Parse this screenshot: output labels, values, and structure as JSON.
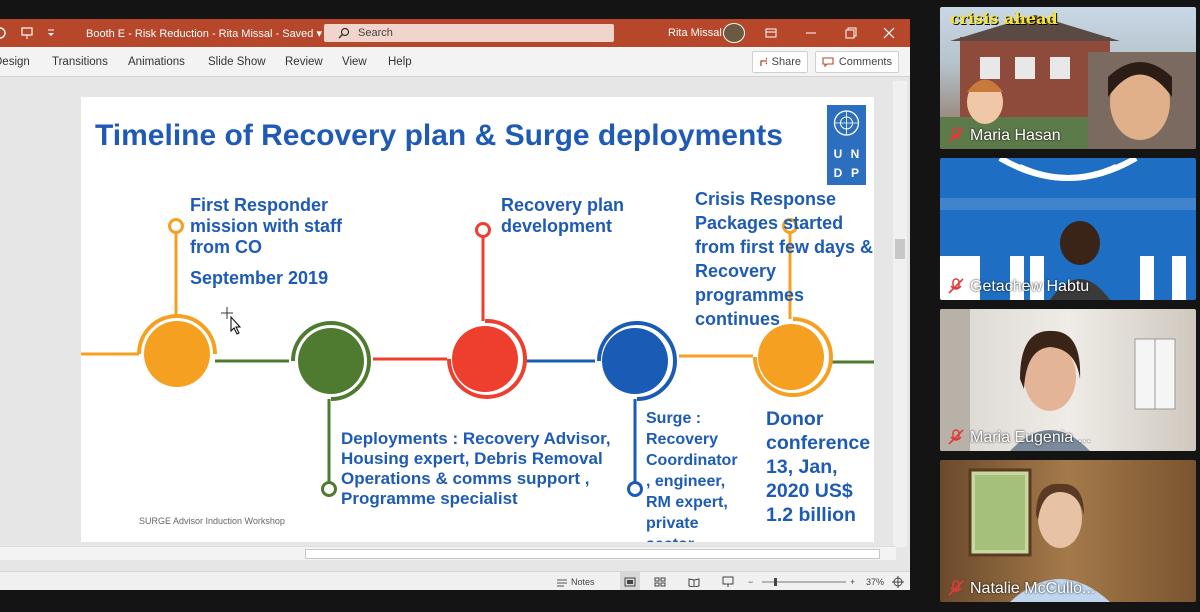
{
  "ppt": {
    "doc_title": "Booth E - Risk Reduction - Rita Missal  -  Saved  ▾",
    "search_placeholder": "Search",
    "user_name": "Rita Missal",
    "tabs": [
      "Design",
      "Transitions",
      "Animations",
      "Slide Show",
      "Review",
      "View",
      "Help"
    ],
    "share_label": "Share",
    "comments_label": "Comments",
    "notes_label": "Notes",
    "zoom": "37%"
  },
  "slide": {
    "title": "Timeline of Recovery plan & Surge deployments",
    "logo_letters": [
      "U",
      "N",
      "D",
      "P"
    ],
    "p1_text": "First Responder mission with staff from CO",
    "p1_date": "September 2019",
    "p2_text": "Deployments : Recovery Advisor, Housing expert, Debris Removal  Operations & comms support , Programme specialist",
    "p3_text": "Recovery plan development",
    "p4_text": "Surge : Recovery Coordinator , engineer, RM expert, private sector",
    "p5_text": "Crisis Response Packages started from first few days & Recovery programmes continues",
    "p6_text": "Donor conference 13, Jan, 2020 US$ 1.2 billion",
    "footer": "SURGE Advisor Induction Workshop",
    "colors": {
      "orange": "#f6a022",
      "green": "#4e7b30",
      "red": "#ee3e2e",
      "blue": "#1a5bb5",
      "title": "#1f5bb4"
    }
  },
  "participants": [
    {
      "name": "Maria Hasan",
      "overlay_text": "crisis ahead"
    },
    {
      "name": "Getachew Habtu"
    },
    {
      "name": "Maria Eugenia ..."
    },
    {
      "name": "Natalie McCullo..."
    }
  ]
}
